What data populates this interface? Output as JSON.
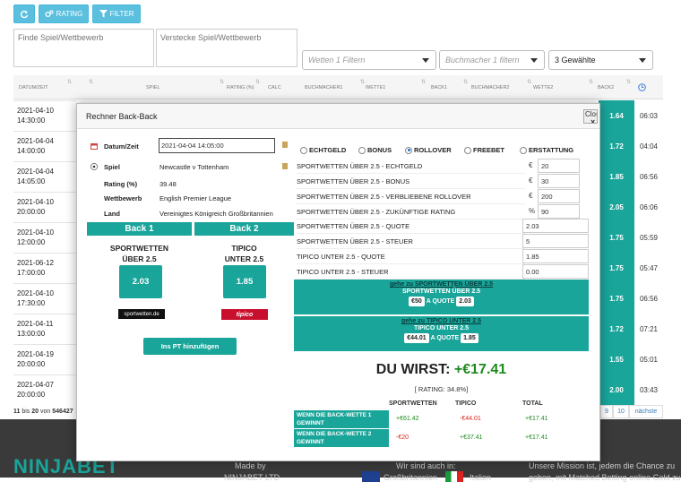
{
  "toolbar": {
    "rating_label": "RATING",
    "filter_label": "FILTER",
    "colors": {
      "info": "#5bc0de"
    }
  },
  "filters": {
    "find_placeholder": "Finde Spiel/Wettbewerb",
    "hide_placeholder": "Verstecke Spiel/Wettbewerb",
    "bets_placeholder": "Wetten 1 Filtern",
    "bookmaker_placeholder": "Buchmacher 1 filtern",
    "selected": "3 Gewählte"
  },
  "table": {
    "headers": [
      "DATUM/ZEIT",
      "SPIEL",
      "RATING (%)",
      "CALC",
      "BUCHMACHER1",
      "WETTE1",
      "BACK1",
      "BUCHMACHER2",
      "WETTE2",
      "BACK2"
    ],
    "rows": [
      {
        "date": "2021-04-10",
        "time": "14:30:00",
        "back2": "1.64",
        "remaining": "06:03"
      },
      {
        "date": "2021-04-04",
        "time": "14:00:00",
        "back2": "1.72",
        "remaining": "04:04"
      },
      {
        "date": "2021-04-04",
        "time": "14:05:00",
        "back2": "1.85",
        "remaining": "06:56"
      },
      {
        "date": "2021-04-10",
        "time": "20:00:00",
        "back2": "2.05",
        "remaining": "06:06"
      },
      {
        "date": "2021-04-10",
        "time": "12:00:00",
        "back2": "1.75",
        "remaining": "05:59"
      },
      {
        "date": "2021-06-12",
        "time": "17:00:00",
        "back2": "1.75",
        "remaining": "05:47"
      },
      {
        "date": "2021-04-10",
        "time": "17:30:00",
        "back2": "1.75",
        "remaining": "06:56"
      },
      {
        "date": "2021-04-11",
        "time": "13:00:00",
        "back2": "1.72",
        "remaining": "07:21"
      },
      {
        "date": "2021-04-19",
        "time": "20:00:00",
        "back2": "1.55",
        "remaining": "05:01"
      },
      {
        "date": "2021-04-07",
        "time": "20:00:00",
        "back2": "2.00",
        "remaining": "03:43"
      }
    ],
    "pagination_info": {
      "from": "11",
      "bis": "bis",
      "to": "20",
      "von": "von",
      "total": "546427"
    },
    "pages": [
      "9",
      "10"
    ],
    "next_label": "nächste"
  },
  "footer": {
    "brand": "NINJABET",
    "made_by": "Made by",
    "company": "NINJABET LTD",
    "also_in": "Wir sind auch in:",
    "country1": "Großbritannien",
    "country2": "Italien",
    "mission": "Unsere Mission ist, jedem die Chance zu",
    "mission2": "geben, mit Matched Betting online Geld zu"
  },
  "modal": {
    "title": "Rechner Back-Back",
    "close_label": "Close",
    "info": {
      "date_label": "Datum/Zeit",
      "date_value": "2021-04-04 14:05:00",
      "match_label": "Spiel",
      "match_value": "Newcastle v Tottenham",
      "rating_label": "Rating (%)",
      "rating_value": "39.48",
      "competition_label": "Wettbewerb",
      "competition_value": "English Premier League",
      "country_label": "Land",
      "country_value": "Vereinigtes Königreich Großbritannien"
    },
    "back1": {
      "header": "Back 1",
      "bet_line1": "SPORTWETTEN",
      "bet_line2": "ÜBER 2.5",
      "odds": "2.03",
      "bookmaker": "sportwetten.de"
    },
    "back2": {
      "header": "Back 2",
      "bet_line1": "TIPICO",
      "bet_line2": "UNTER 2.5",
      "odds": "1.85",
      "bookmaker": "tipico"
    },
    "add_pt_label": "Ins PT hinzufügen",
    "modes": [
      "ECHTGELD",
      "BONUS",
      "ROLLOVER",
      "FREEBET",
      "ERSTATTUNG"
    ],
    "selected_mode": "ROLLOVER",
    "fields": [
      {
        "label": "SPORTWETTEN ÜBER 2.5 - ECHTGELD",
        "unit": "€",
        "value": "20"
      },
      {
        "label": "SPORTWETTEN ÜBER 2.5 - BONUS",
        "unit": "€",
        "value": "30"
      },
      {
        "label": "SPORTWETTEN ÜBER 2.5 - VERBLIEBENE ROLLOVER",
        "unit": "€",
        "value": "200"
      },
      {
        "label": "SPORTWETTEN ÜBER 2.5 - ZUKÜNFTIGE RATING",
        "unit": "%",
        "value": "90"
      },
      {
        "label": "SPORTWETTEN ÜBER 2.5 - QUOTE",
        "unit": "",
        "value": "2.03"
      },
      {
        "label": "SPORTWETTEN ÜBER 2.5 - STEUER",
        "unit": "",
        "value": "5"
      },
      {
        "label": "TIPICO UNTER 2.5  - QUOTE",
        "unit": "",
        "value": "1.85"
      },
      {
        "label": "TIPICO UNTER 2.5 - STEUER",
        "unit": "",
        "value": "0.00"
      }
    ],
    "stake1": {
      "link": "gehe zu SPORTWETTEN ÜBER 2.5",
      "title": "SPORTWETTEN ÜBER 2.5",
      "stake": "€50",
      "at_quote": "A QUOTE",
      "quote": "2.03"
    },
    "stake2": {
      "link": "gehe zu TIPICO UNTER 2.5",
      "title": "TIPICO UNTER 2.5",
      "stake": "€44.01",
      "at_quote": "A QUOTE",
      "quote": "1.85"
    },
    "result": {
      "prefix": "DU WIRST:",
      "amount": "+€17.41",
      "rating": "[ RATING: 34.8%]"
    },
    "outcome_headers": [
      "SPORTWETTEN",
      "TIPICO",
      "TOTAL"
    ],
    "outcomes": [
      {
        "label": "WENN DIE BACK-WETTE 1 GEWINNT",
        "sport": "+€61.42",
        "tipico": "-€44.01",
        "total": "+€17.41"
      },
      {
        "label": "WENN DIE BACK-WETTE 2 GEWINNT",
        "sport": "-€20",
        "tipico": "+€37.41",
        "total": "+€17.41"
      }
    ],
    "colors": {
      "teal": "#1aa59a",
      "positive": "#1e8a1e",
      "negative": "#d9261c"
    }
  }
}
